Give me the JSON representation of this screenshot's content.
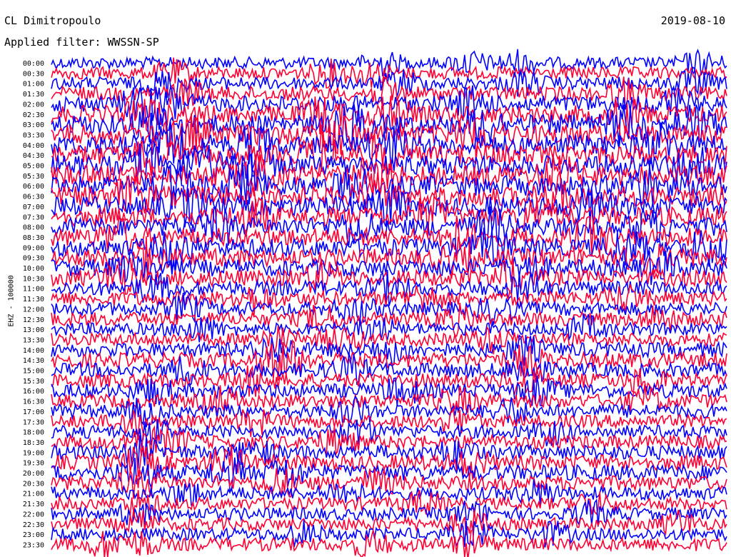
{
  "header": {
    "station": "CL Dimitropoulo",
    "filter": "Applied filter: WWSSN-SP",
    "date": "2019-08-10"
  },
  "colors": {
    "trace_a": "#0000ff",
    "trace_b": "#ff0033"
  },
  "chart_data": {
    "type": "line",
    "title": "CL Dimitropoulo",
    "subtitle": "Applied filter: WWSSN-SP",
    "ylabel": "EHZ - 100000",
    "xlabel": "",
    "grid": false,
    "legend": "none",
    "trace_colors_alternating": [
      "#0000ff",
      "#ff0033"
    ],
    "rows": [
      {
        "label": "00:00",
        "amp": 0.35,
        "bursts": [
          0.49,
          0.62,
          0.69,
          0.96
        ]
      },
      {
        "label": "00:30",
        "amp": 0.4,
        "bursts": [
          0.18,
          0.41,
          0.47
        ]
      },
      {
        "label": "01:00",
        "amp": 0.45,
        "bursts": [
          0.17,
          0.52,
          0.7,
          0.95
        ]
      },
      {
        "label": "01:30",
        "amp": 0.55,
        "bursts": [
          0.2,
          0.5,
          0.85
        ]
      },
      {
        "label": "02:00",
        "amp": 0.7,
        "bursts": [
          0.13,
          0.18,
          0.62,
          0.92
        ]
      },
      {
        "label": "02:30",
        "amp": 0.8,
        "bursts": [
          0.14,
          0.4,
          0.5,
          0.85
        ]
      },
      {
        "label": "03:00",
        "amp": 0.95,
        "bursts": [
          0.15,
          0.45,
          0.64,
          0.85,
          0.95
        ]
      },
      {
        "label": "03:30",
        "amp": 1.0,
        "bursts": [
          0.2,
          0.42,
          0.63
        ]
      },
      {
        "label": "04:00",
        "amp": 1.0,
        "bursts": [
          0.18,
          0.3,
          0.5,
          0.9
        ]
      },
      {
        "label": "04:30",
        "amp": 1.0,
        "bursts": [
          0.15,
          0.4,
          0.49
        ]
      },
      {
        "label": "05:00",
        "amp": 1.0,
        "bursts": [
          0.14,
          0.22,
          0.3,
          0.95
        ]
      },
      {
        "label": "05:30",
        "amp": 1.0,
        "bursts": [
          0.3,
          0.48,
          0.75
        ]
      },
      {
        "label": "06:00",
        "amp": 1.0,
        "bursts": [
          0.18,
          0.28,
          0.45,
          0.88
        ]
      },
      {
        "label": "06:30",
        "amp": 1.0,
        "bursts": [
          0.12,
          0.48,
          0.75
        ]
      },
      {
        "label": "07:00",
        "amp": 0.95,
        "bursts": [
          0.2,
          0.5,
          0.8
        ]
      },
      {
        "label": "07:30",
        "amp": 0.9,
        "bursts": [
          0.3,
          0.56,
          0.72
        ]
      },
      {
        "label": "08:00",
        "amp": 0.85,
        "bursts": [
          0.25,
          0.45,
          0.65,
          0.88
        ]
      },
      {
        "label": "08:30",
        "amp": 0.85,
        "bursts": [
          0.1,
          0.6,
          0.8
        ]
      },
      {
        "label": "09:00",
        "amp": 0.85,
        "bursts": [
          0.18,
          0.65,
          0.85,
          0.97
        ]
      },
      {
        "label": "09:30",
        "amp": 0.8,
        "bursts": [
          0.14,
          0.6,
          0.88
        ]
      },
      {
        "label": "10:00",
        "amp": 0.75,
        "bursts": [
          0.12,
          0.7,
          0.9
        ]
      },
      {
        "label": "10:30",
        "amp": 0.7,
        "bursts": [
          0.1,
          0.4,
          0.68
        ]
      },
      {
        "label": "11:00",
        "amp": 0.6,
        "bursts": [
          0.15,
          0.5,
          0.7
        ]
      },
      {
        "label": "11:30",
        "amp": 0.55,
        "bursts": [
          0.3,
          0.55,
          0.85
        ]
      },
      {
        "label": "12:00",
        "amp": 0.5,
        "bursts": [
          0.2,
          0.45,
          0.66
        ]
      },
      {
        "label": "12:30",
        "amp": 0.5,
        "bursts": [
          0.4,
          0.6,
          0.9
        ]
      },
      {
        "label": "13:00",
        "amp": 0.45,
        "bursts": [
          0.22,
          0.48,
          0.79
        ]
      },
      {
        "label": "13:30",
        "amp": 0.45,
        "bursts": [
          0.33,
          0.43,
          0.65
        ]
      },
      {
        "label": "14:00",
        "amp": 0.55,
        "bursts": [
          0.33,
          0.5,
          0.7
        ]
      },
      {
        "label": "14:30",
        "amp": 0.6,
        "bursts": [
          0.33,
          0.36,
          0.7
        ]
      },
      {
        "label": "15:00",
        "amp": 0.55,
        "bursts": [
          0.2,
          0.44,
          0.7
        ]
      },
      {
        "label": "15:30",
        "amp": 0.55,
        "bursts": [
          0.3,
          0.7,
          0.88
        ]
      },
      {
        "label": "16:00",
        "amp": 0.55,
        "bursts": [
          0.15,
          0.52,
          0.72
        ]
      },
      {
        "label": "16:30",
        "amp": 0.5,
        "bursts": [
          0.25,
          0.6,
          0.88
        ]
      },
      {
        "label": "17:00",
        "amp": 0.5,
        "bursts": [
          0.14,
          0.45,
          0.68
        ]
      },
      {
        "label": "17:30",
        "amp": 0.45,
        "bursts": [
          0.12,
          0.3,
          0.6
        ]
      },
      {
        "label": "18:00",
        "amp": 0.45,
        "bursts": [
          0.15,
          0.45,
          0.74
        ]
      },
      {
        "label": "18:30",
        "amp": 0.5,
        "bursts": [
          0.13,
          0.18,
          0.42
        ]
      },
      {
        "label": "19:00",
        "amp": 0.55,
        "bursts": [
          0.13,
          0.3,
          0.6
        ]
      },
      {
        "label": "19:30",
        "amp": 0.6,
        "bursts": [
          0.13,
          0.26,
          0.62
        ]
      },
      {
        "label": "20:00",
        "amp": 0.65,
        "bursts": [
          0.13,
          0.26,
          0.35
        ]
      },
      {
        "label": "20:30",
        "amp": 0.55,
        "bursts": [
          0.13,
          0.34,
          0.48
        ]
      },
      {
        "label": "21:00",
        "amp": 0.45,
        "bursts": [
          0.2,
          0.43,
          0.72
        ]
      },
      {
        "label": "21:30",
        "amp": 0.4,
        "bursts": [
          0.13,
          0.55,
          0.8
        ]
      },
      {
        "label": "22:00",
        "amp": 0.4,
        "bursts": [
          0.13,
          0.62,
          0.8
        ]
      },
      {
        "label": "22:30",
        "amp": 0.4,
        "bursts": [
          0.13,
          0.62,
          0.93
        ]
      },
      {
        "label": "23:00",
        "amp": 0.4,
        "bursts": [
          0.37,
          0.62,
          0.74
        ]
      },
      {
        "label": "23:30",
        "amp": 0.45,
        "bursts": [
          0.08,
          0.13,
          0.47,
          0.62
        ]
      }
    ]
  }
}
